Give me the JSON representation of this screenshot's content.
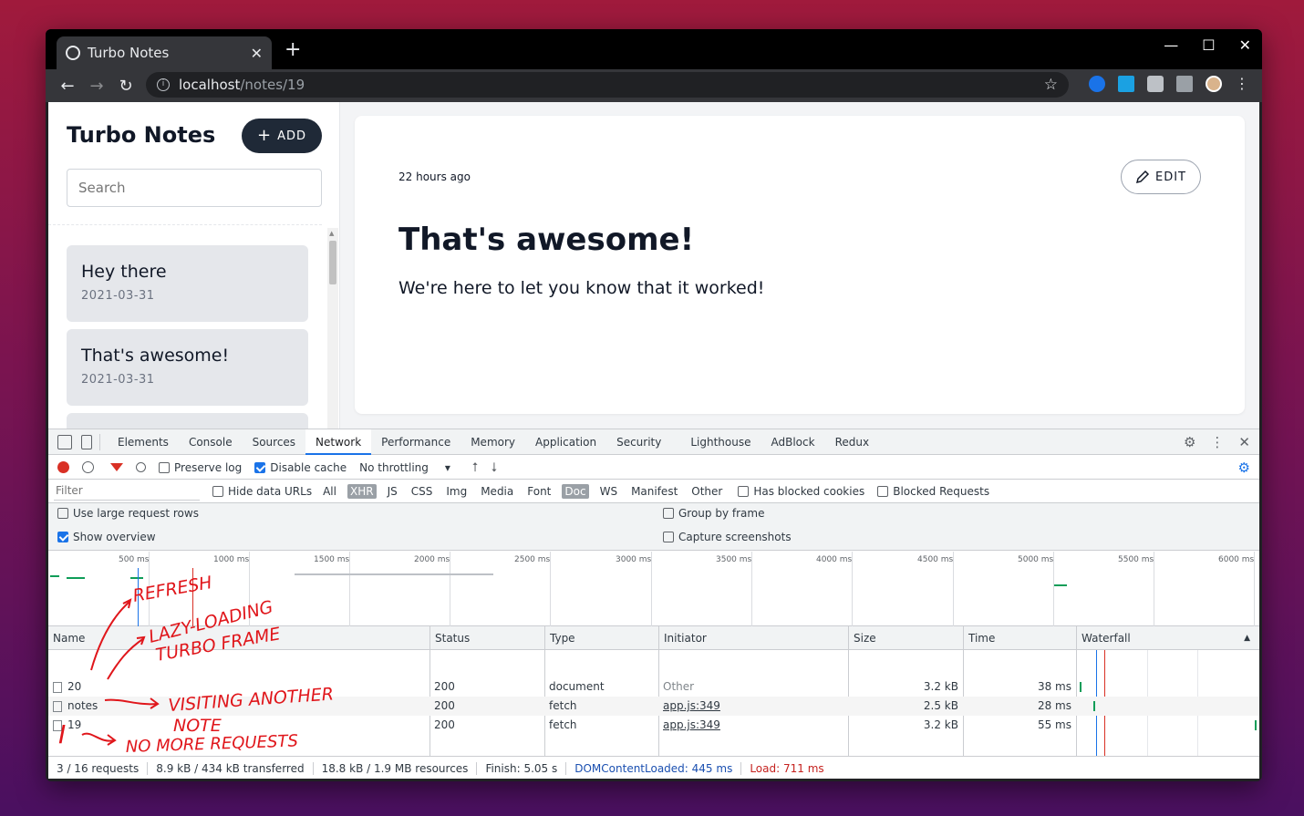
{
  "browser": {
    "tab_title": "Turbo Notes",
    "tab_close": "✕",
    "new_tab": "+",
    "url_host": "localhost",
    "url_path": "/notes/19",
    "star": "☆",
    "win_min": "—",
    "win_max": "☐",
    "win_close": "✕",
    "back": "←",
    "forward": "→",
    "reload": "↻",
    "menu": "⋮"
  },
  "sidebar": {
    "title": "Turbo Notes",
    "add_label": "ADD",
    "add_icon": "+",
    "search_placeholder": "Search",
    "notes": [
      {
        "title": "Hey there",
        "date": "2021-03-31"
      },
      {
        "title": "That's awesome!",
        "date": "2021-03-31"
      }
    ]
  },
  "note": {
    "time_ago": "22 hours ago",
    "edit_label": "EDIT",
    "title": "That's awesome!",
    "body": "We're here to let you know that it worked!"
  },
  "devtools": {
    "tabs": [
      "Elements",
      "Console",
      "Sources",
      "Network",
      "Performance",
      "Memory",
      "Application",
      "Security",
      "Lighthouse",
      "AdBlock",
      "Redux"
    ],
    "active_tab": "Network",
    "preserve_log": "Preserve log",
    "disable_cache": "Disable cache",
    "throttling": "No throttling",
    "filter_placeholder": "Filter",
    "hide_data_urls": "Hide data URLs",
    "filter_types": [
      "All",
      "XHR",
      "JS",
      "CSS",
      "Img",
      "Media",
      "Font",
      "Doc",
      "WS",
      "Manifest",
      "Other"
    ],
    "has_blocked_cookies": "Has blocked cookies",
    "blocked_requests": "Blocked Requests",
    "use_large_rows": "Use large request rows",
    "show_overview": "Show overview",
    "group_by_frame": "Group by frame",
    "capture_screenshots": "Capture screenshots",
    "timeline_ticks": [
      "500 ms",
      "1000 ms",
      "1500 ms",
      "2000 ms",
      "2500 ms",
      "3000 ms",
      "3500 ms",
      "4000 ms",
      "4500 ms",
      "5000 ms",
      "5500 ms",
      "6000 ms"
    ],
    "columns": [
      "Name",
      "Status",
      "Type",
      "Initiator",
      "Size",
      "Time",
      "Waterfall"
    ],
    "sort_indicator": "▲",
    "requests": [
      {
        "name": "20",
        "status": "200",
        "type": "document",
        "initiator": "Other",
        "size": "3.2 kB",
        "time": "38 ms"
      },
      {
        "name": "notes",
        "status": "200",
        "type": "fetch",
        "initiator": "app.js:349",
        "size": "2.5 kB",
        "time": "28 ms"
      },
      {
        "name": "19",
        "status": "200",
        "type": "fetch",
        "initiator": "app.js:349",
        "size": "3.2 kB",
        "time": "55 ms"
      }
    ],
    "summary": {
      "requests": "3 / 16 requests",
      "transferred": "8.9 kB / 434 kB transferred",
      "resources": "18.8 kB / 1.9 MB resources",
      "finish": "Finish: 5.05 s",
      "dcl": "DOMContentLoaded: 445 ms",
      "load": "Load: 711 ms"
    }
  },
  "annotations": {
    "refresh": "REFRESH",
    "lazy": "LAZY-LOADING",
    "turbo_frame": "TURBO FRAME",
    "visiting": "VISITING ANOTHER",
    "note": "NOTE",
    "cursor": "I",
    "no_more": "NO MORE REQUESTS"
  },
  "colors": {
    "accent_blue": "#1a73e8",
    "record_red": "#d93025",
    "annotation_red": "#e0161b",
    "add_button_bg": "#1f2937"
  }
}
